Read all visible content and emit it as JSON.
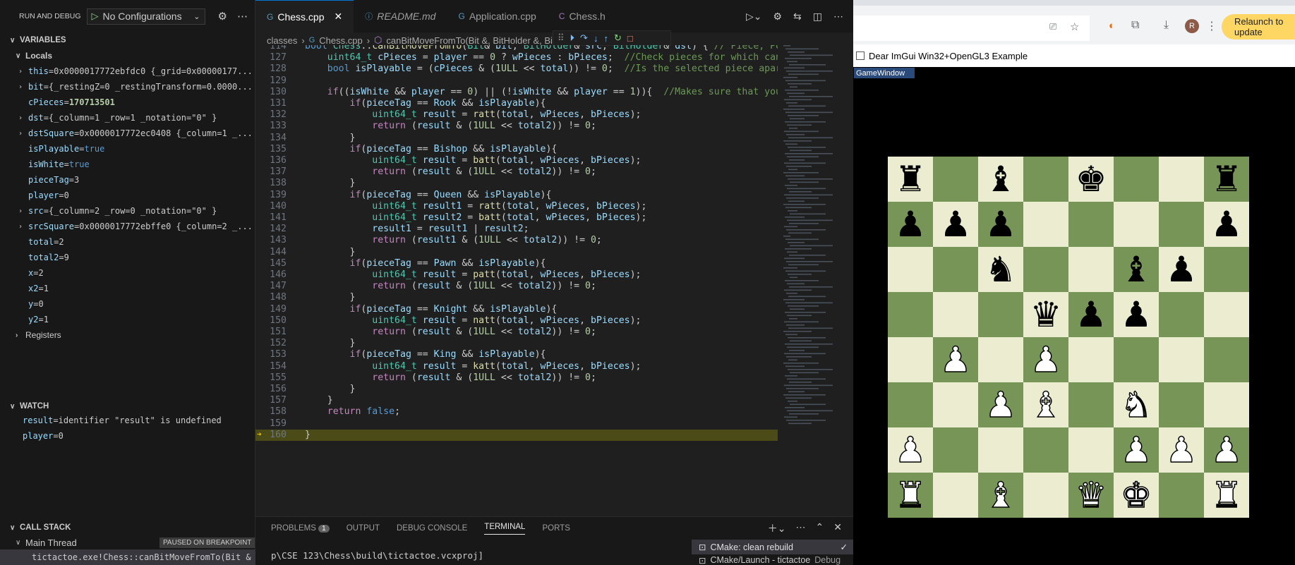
{
  "debug": {
    "run_label": "RUN AND DEBUG",
    "config": "No Configurations",
    "variables_title": "VARIABLES",
    "locals_title": "Locals",
    "locals": [
      {
        "name": "this",
        "value": "0x0000017772ebfdc0 {_grid=0x00000177...",
        "exp": true
      },
      {
        "name": "bit",
        "value": "{_restingZ=0 _restingTransform=0.0000...",
        "exp": true
      },
      {
        "name": "cPieces",
        "value": "170713501",
        "exp": false,
        "cls": "num"
      },
      {
        "name": "dst",
        "value": "{_column=1 _row=1 _notation=\"0\" }",
        "exp": true
      },
      {
        "name": "dstSquare",
        "value": "0x0000017772ec0408 {_column=1 _...",
        "exp": true
      },
      {
        "name": "isPlayable",
        "value": "true",
        "exp": false,
        "cls": "bool"
      },
      {
        "name": "isWhite",
        "value": "true",
        "exp": false,
        "cls": "bool"
      },
      {
        "name": "pieceTag",
        "value": "3",
        "exp": false
      },
      {
        "name": "player",
        "value": "0",
        "exp": false
      },
      {
        "name": "src",
        "value": "{_column=2 _row=0 _notation=\"0\" }",
        "exp": true
      },
      {
        "name": "srcSquare",
        "value": "0x0000017772ebffe0 {_column=2 _...",
        "exp": true
      },
      {
        "name": "total",
        "value": "2",
        "exp": false
      },
      {
        "name": "total2",
        "value": "9",
        "exp": false
      },
      {
        "name": "x",
        "value": "2",
        "exp": false
      },
      {
        "name": "x2",
        "value": "1",
        "exp": false
      },
      {
        "name": "y",
        "value": "0",
        "exp": false
      },
      {
        "name": "y2",
        "value": "1",
        "exp": false
      }
    ],
    "registers": "Registers",
    "watch_title": "WATCH",
    "watch": [
      {
        "name": "result",
        "value": "identifier \"result\" is undefined"
      },
      {
        "name": "player",
        "value": "0"
      }
    ],
    "callstack_title": "CALL STACK",
    "thread": "Main Thread",
    "paused": "PAUSED ON BREAKPOINT",
    "frame": "tictactoe.exe!Chess::canBitMoveFromTo(Bit & b"
  },
  "editor": {
    "tabs": [
      "Chess.cpp",
      "README.md",
      "Application.cpp",
      "Chess.h"
    ],
    "crumbs": [
      "classes",
      "Chess.cpp",
      "canBitMoveFromTo(Bit &, BitHolder &, BitHolder &)"
    ],
    "lines": [
      {
        "n": "114",
        "t": "bool Chess::canBitMoveFromTo(Bit& bit, BitHolder& src, BitHolder& dst) { // Piece, Posi"
      },
      {
        "n": "127",
        "t": "    uint64_t cPieces = player == 0 ? wPieces : bPieces;  //Check pieces for which can b"
      },
      {
        "n": "128",
        "t": "    bool isPlayable = (cPieces & (1ULL << total)) != 0;  //Is the selected piece apart"
      },
      {
        "n": "129",
        "t": ""
      },
      {
        "n": "130",
        "t": "    if((isWhite && player == 0) || (!isWhite && player == 1)){  //Makes sure that you d"
      },
      {
        "n": "131",
        "t": "        if(pieceTag == Rook && isPlayable){"
      },
      {
        "n": "132",
        "t": "            uint64_t result = ratt(total, wPieces, bPieces);"
      },
      {
        "n": "133",
        "t": "            return (result & (1ULL << total2)) != 0;"
      },
      {
        "n": "134",
        "t": "        }"
      },
      {
        "n": "135",
        "t": "        if(pieceTag == Bishop && isPlayable){"
      },
      {
        "n": "136",
        "t": "            uint64_t result = batt(total, wPieces, bPieces);"
      },
      {
        "n": "137",
        "t": "            return (result & (1ULL << total2)) != 0;"
      },
      {
        "n": "138",
        "t": "        }"
      },
      {
        "n": "139",
        "t": "        if(pieceTag == Queen && isPlayable){"
      },
      {
        "n": "140",
        "t": "            uint64_t result1 = ratt(total, wPieces, bPieces);"
      },
      {
        "n": "141",
        "t": "            uint64_t result2 = batt(total, wPieces, bPieces);"
      },
      {
        "n": "142",
        "t": "            result1 = result1 | result2;"
      },
      {
        "n": "143",
        "t": "            return (result1 & (1ULL << total2)) != 0;"
      },
      {
        "n": "144",
        "t": "        }"
      },
      {
        "n": "145",
        "t": "        if(pieceTag == Pawn && isPlayable){"
      },
      {
        "n": "146",
        "t": "            uint64_t result = patt(total, wPieces, bPieces);"
      },
      {
        "n": "147",
        "t": "            return (result & (1ULL << total2)) != 0;"
      },
      {
        "n": "148",
        "t": "        }"
      },
      {
        "n": "149",
        "t": "        if(pieceTag == Knight && isPlayable){"
      },
      {
        "n": "150",
        "t": "            uint64_t result = natt(total, wPieces, bPieces);"
      },
      {
        "n": "151",
        "t": "            return (result & (1ULL << total2)) != 0;"
      },
      {
        "n": "152",
        "t": "        }"
      },
      {
        "n": "153",
        "t": "        if(pieceTag == King && isPlayable){"
      },
      {
        "n": "154",
        "t": "            uint64_t result = katt(total, wPieces, bPieces);"
      },
      {
        "n": "155",
        "t": "            return (result & (1ULL << total2)) != 0;"
      },
      {
        "n": "156",
        "t": "        }"
      },
      {
        "n": "157",
        "t": "    }"
      },
      {
        "n": "158",
        "t": "    return false;"
      },
      {
        "n": "159",
        "t": ""
      },
      {
        "n": "160",
        "t": "}"
      }
    ]
  },
  "panel": {
    "tabs": [
      "PROBLEMS",
      "OUTPUT",
      "DEBUG CONSOLE",
      "TERMINAL",
      "PORTS"
    ],
    "problems_count": "1",
    "terminal_line": "p\\CSE 123\\Chess\\build\\tictactoe.vcxproj]",
    "task1": "CMake: clean rebuild",
    "task2": "CMake/Launch - tictactoe",
    "task2_suffix": "Debug"
  },
  "browser": {
    "relaunch": "Relaunch to update",
    "avatar": "R",
    "window_title": "Dear ImGui Win32+OpenGL3 Example",
    "game_window": "GameWindow"
  },
  "board": {
    "light": "#ebecd0",
    "dark": "#779556",
    "rows": [
      [
        "bR",
        "",
        "bB",
        "",
        "bK",
        "",
        "",
        "bR"
      ],
      [
        "bP",
        "bP",
        "bP",
        "",
        "",
        "",
        "",
        "bP"
      ],
      [
        "",
        "",
        "bN",
        "",
        "",
        "bB",
        "bP",
        ""
      ],
      [
        "",
        "",
        "",
        "bQ",
        "bP",
        "bP",
        "",
        ""
      ],
      [
        "",
        "wP",
        "",
        "wP",
        "",
        "",
        "",
        ""
      ],
      [
        "",
        "",
        "wP",
        "wB",
        "",
        "wN",
        "",
        ""
      ],
      [
        "wP",
        "",
        "",
        "",
        "",
        "wP",
        "wP",
        "wP"
      ],
      [
        "wR",
        "",
        "wB",
        "",
        "wQ",
        "wK",
        "",
        "wR"
      ]
    ]
  }
}
